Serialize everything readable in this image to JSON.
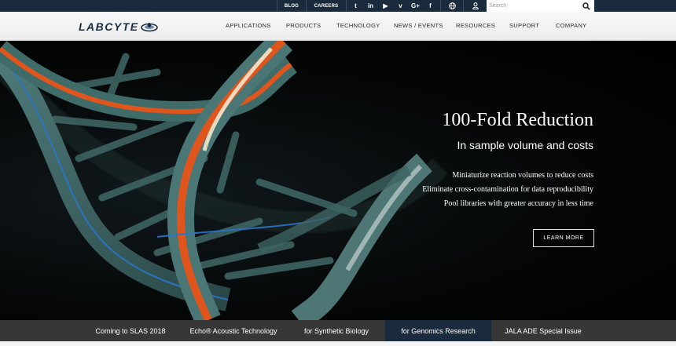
{
  "topbar": {
    "blog_label": "BLOG",
    "careers_label": "CAREERS",
    "social": [
      {
        "icon": "twitter-icon",
        "glyph": "t"
      },
      {
        "icon": "linkedin-icon",
        "glyph": "in"
      },
      {
        "icon": "youtube-icon",
        "glyph": "▶"
      },
      {
        "icon": "vimeo-icon",
        "glyph": "v"
      },
      {
        "icon": "google-plus-icon",
        "glyph": "G+"
      },
      {
        "icon": "facebook-icon",
        "glyph": "f"
      }
    ],
    "globe_icon": "globe-icon",
    "user_icon": "user-icon",
    "search_placeholder": "Search"
  },
  "header": {
    "logo_text": "LABCYTE",
    "nav": [
      {
        "label": "APPLICATIONS"
      },
      {
        "label": "PRODUCTS"
      },
      {
        "label": "TECHNOLOGY"
      },
      {
        "label": "NEWS / EVENTS"
      },
      {
        "label": "RESOURCES"
      },
      {
        "label": "SUPPORT"
      },
      {
        "label": "COMPANY"
      }
    ]
  },
  "hero": {
    "title": "100-Fold Reduction",
    "subtitle": "In sample volume and costs",
    "bullets": [
      "Miniaturize reaction volumes to reduce costs",
      "Eliminate cross-contamination for data reproducibility",
      "Pool libraries with greater accuracy in less time"
    ],
    "button_label": "LEARN MORE"
  },
  "tabs": [
    {
      "label": "Coming to SLAS 2018",
      "active": false
    },
    {
      "label": "Echo® Acoustic Technology",
      "active": false
    },
    {
      "label": "for Synthetic Biology",
      "active": false
    },
    {
      "label": "for Genomics Research",
      "active": true
    },
    {
      "label": "JALA ADE Special Issue",
      "active": false
    }
  ],
  "colors": {
    "topbar_bg": "#1b2b3e",
    "accent_orange": "#e0551c",
    "accent_blue": "#2a74c9",
    "strand_teal": "#5f8e8c"
  }
}
